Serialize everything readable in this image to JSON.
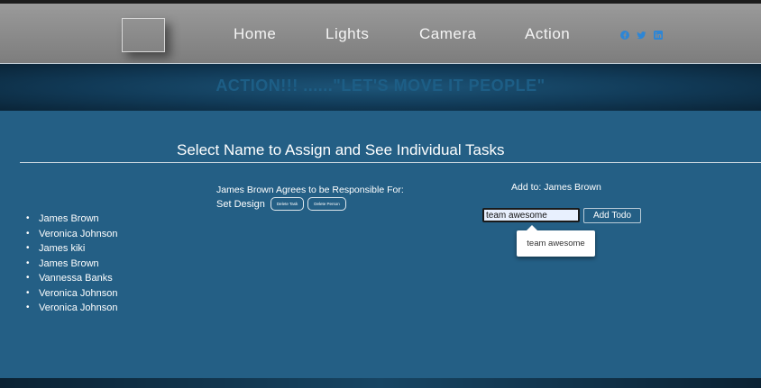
{
  "nav": {
    "links": [
      "Home",
      "Lights",
      "Camera",
      "Action"
    ],
    "social_icons": [
      "facebook-icon",
      "twitter-icon",
      "linkedin-icon"
    ],
    "social_color": "#2d86d6"
  },
  "hero": {
    "title": "ACTION!!! ......\"LET'S MOVE IT PEOPLE\""
  },
  "main": {
    "section_title": "Select Name to Assign and See Individual Tasks",
    "people": [
      "James Brown",
      "Veronica Johnson",
      "James kiki",
      "James Brown",
      "Vannessa Banks",
      "Veronica Johnson",
      "Veronica Johnson"
    ],
    "responsibility_label": "James Brown Agrees to be Responsible For:",
    "task": {
      "name": "Set Design",
      "delete_task_label": "Delete Task",
      "delete_person_label": "Delete Person"
    },
    "add_to_label": "Add to: James Brown",
    "todo_input_value": "team awesome",
    "add_todo_label": "Add Todo",
    "autocomplete_suggestion": "team awesome"
  },
  "colors": {
    "nav_bg": "#8a8a8a",
    "hero_bg": "#113a57",
    "main_bg": "#245f85",
    "hero_text": "#1d5e86"
  }
}
